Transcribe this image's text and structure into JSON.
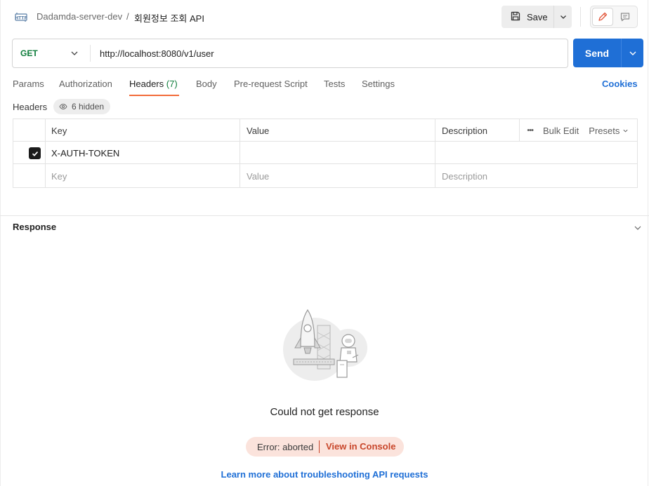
{
  "header": {
    "collection": "Dadamda-server-dev",
    "separator": "/",
    "request_name": "회원정보 조회 API",
    "save_label": "Save",
    "icons": {
      "request_type": "http-icon",
      "save": "save-icon",
      "edit": "pencil-icon",
      "comment": "comment-icon"
    }
  },
  "request": {
    "method": "GET",
    "url": "http://localhost:8080/v1/user",
    "send_label": "Send"
  },
  "tabs": [
    {
      "label": "Params"
    },
    {
      "label": "Authorization"
    },
    {
      "label": "Headers",
      "count": "(7)",
      "active": true
    },
    {
      "label": "Body"
    },
    {
      "label": "Pre-request Script"
    },
    {
      "label": "Tests"
    },
    {
      "label": "Settings"
    }
  ],
  "cookies_label": "Cookies",
  "headers_section": {
    "label": "Headers",
    "hidden_label": "6 hidden",
    "columns": {
      "key": "Key",
      "value": "Value",
      "description": "Description"
    },
    "actions": {
      "more": "•••",
      "bulk_edit": "Bulk Edit",
      "presets": "Presets"
    },
    "rows": [
      {
        "checked": true,
        "key": "X-AUTH-TOKEN",
        "value": "",
        "description": ""
      }
    ],
    "new_row": {
      "key_placeholder": "Key",
      "value_placeholder": "Value",
      "description_placeholder": "Description"
    }
  },
  "response": {
    "title": "Response",
    "empty_message": "Could not get response",
    "error_text": "Error: aborted",
    "console_link": "View in Console",
    "learn_link": "Learn more about troubleshooting API requests"
  },
  "colors": {
    "accent_blue": "#1f6fd6",
    "method_green": "#0d7c3a",
    "tab_underline": "#f26b3a",
    "error_bg": "#fbe3dc",
    "error_text": "#c8462a"
  }
}
